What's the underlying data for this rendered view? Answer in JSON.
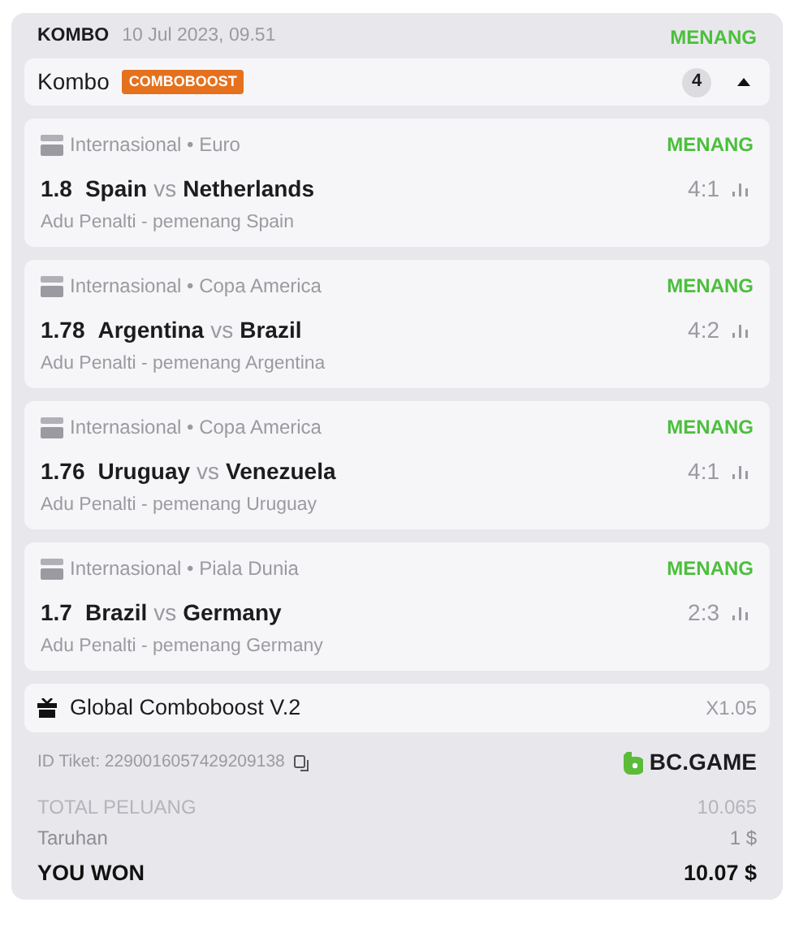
{
  "header": {
    "type": "KOMBO",
    "date": "10 Jul 2023, 09.51",
    "status": "MENANG"
  },
  "combo": {
    "title": "Kombo",
    "badge": "COMBOBOOST",
    "count": "4",
    "expanded": true
  },
  "matches": [
    {
      "league": "Internasional • Euro",
      "status": "MENANG",
      "odds": "1.8",
      "home": "Spain",
      "vs": "vs",
      "away": "Netherlands",
      "score": "4:1",
      "market": "Adu Penalti - pemenang Spain"
    },
    {
      "league": "Internasional • Copa America",
      "status": "MENANG",
      "odds": "1.78",
      "home": "Argentina",
      "vs": "vs",
      "away": "Brazil",
      "score": "4:2",
      "market": "Adu Penalti - pemenang Argentina"
    },
    {
      "league": "Internasional • Copa America",
      "status": "MENANG",
      "odds": "1.76",
      "home": "Uruguay",
      "vs": "vs",
      "away": "Venezuela",
      "score": "4:1",
      "market": "Adu Penalti - pemenang Uruguay"
    },
    {
      "league": "Internasional • Piala Dunia",
      "status": "MENANG",
      "odds": "1.7",
      "home": "Brazil",
      "vs": "vs",
      "away": "Germany",
      "score": "2:3",
      "market": "Adu Penalti - pemenang Germany"
    }
  ],
  "boost": {
    "label": "Global Comboboost V.2",
    "multiplier": "X1.05"
  },
  "ticket": {
    "id": "ID Tiket: 2290016057429209138",
    "brand": "BC.GAME"
  },
  "summary": [
    {
      "label": "TOTAL PELUANG",
      "value": "10.065",
      "kind": "muted"
    },
    {
      "label": "Taruhan",
      "value": "1 $",
      "kind": "normal"
    },
    {
      "label": "YOU WON",
      "value": "10.07 $",
      "kind": "total"
    }
  ]
}
